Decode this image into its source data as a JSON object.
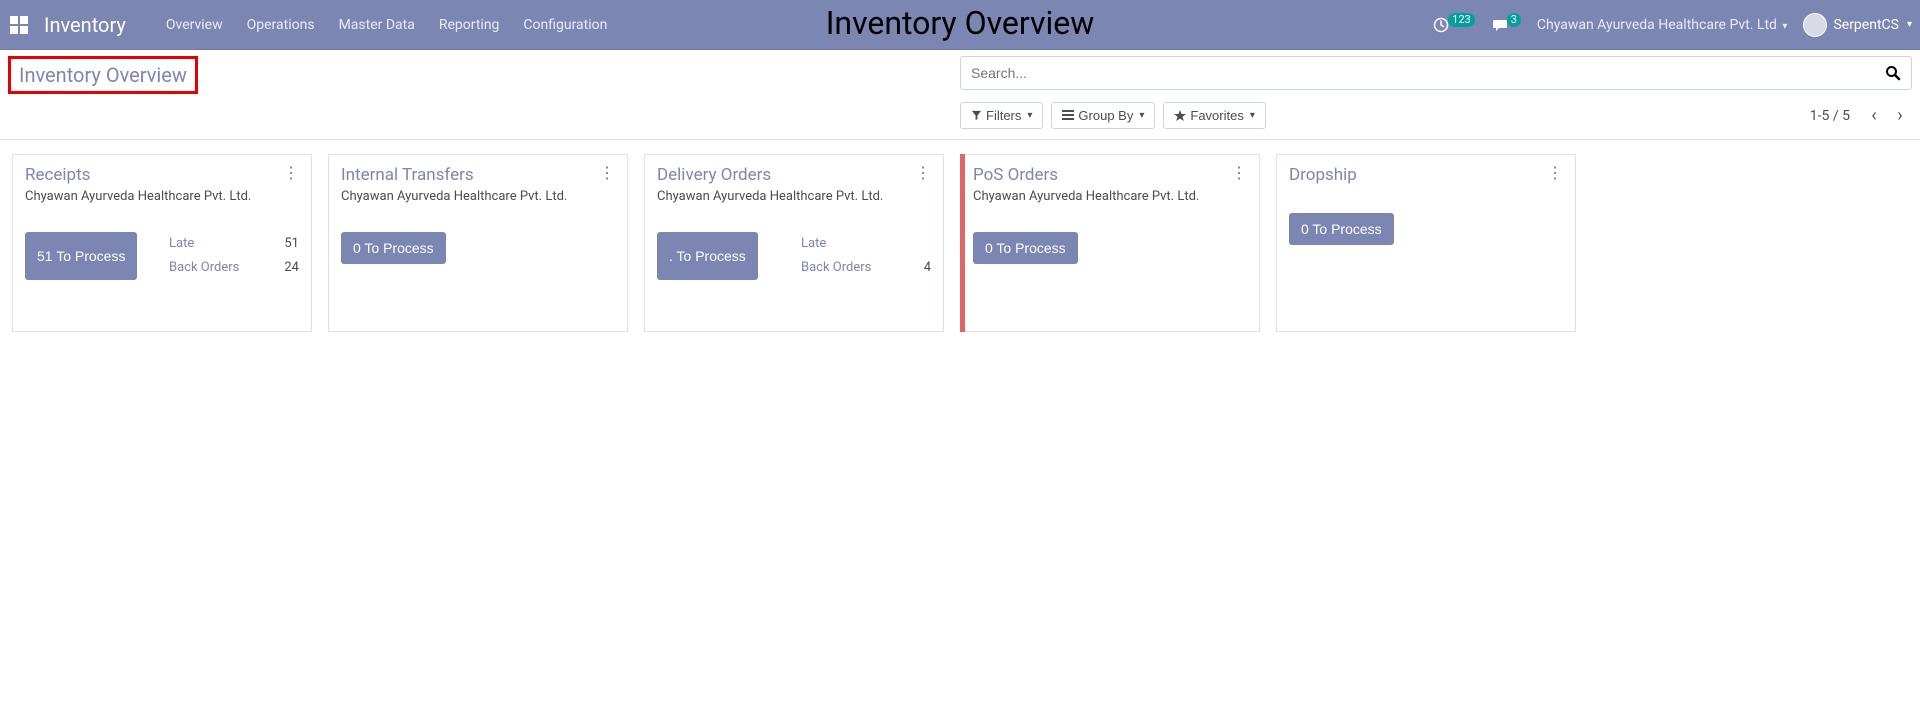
{
  "header": {
    "app_name": "Inventory",
    "menu": [
      "Overview",
      "Operations",
      "Master Data",
      "Reporting",
      "Configuration"
    ],
    "overlay_title": "Inventory Overview",
    "activity_count": "123",
    "discuss_count": "3",
    "company": "Chyawan Ayurveda Healthcare Pvt. Ltd",
    "user": "SerpentCS"
  },
  "control": {
    "breadcrumb": "Inventory Overview",
    "search_placeholder": "Search...",
    "filters_label": "Filters",
    "groupby_label": "Group By",
    "favorites_label": "Favorites",
    "pager": "1-5 / 5"
  },
  "cards": [
    {
      "id": "receipts",
      "title": "Receipts",
      "subtitle": "Chyawan Ayurveda Healthcare Pvt. Ltd.",
      "button": "51 To Process",
      "has_bar": false,
      "stats": [
        {
          "label": "Late",
          "value": "51"
        },
        {
          "label": "Back Orders",
          "value": "24"
        }
      ]
    },
    {
      "id": "internal-transfers",
      "title": "Internal Transfers",
      "subtitle": "Chyawan Ayurveda Healthcare Pvt. Ltd.",
      "button": "0 To Process",
      "has_bar": false,
      "stats": []
    },
    {
      "id": "delivery-orders",
      "title": "Delivery Orders",
      "subtitle": "Chyawan Ayurveda Healthcare Pvt. Ltd.",
      "button": ". To Process",
      "has_bar": false,
      "stats": [
        {
          "label": "Late",
          "value": ""
        },
        {
          "label": "Back Orders",
          "value": "4"
        }
      ]
    },
    {
      "id": "pos-orders",
      "title": "PoS Orders",
      "subtitle": "Chyawan Ayurveda Healthcare Pvt. Ltd.",
      "button": "0 To Process",
      "has_bar": true,
      "stats": []
    },
    {
      "id": "dropship",
      "title": "Dropship",
      "subtitle": "",
      "button": "0 To Process",
      "has_bar": false,
      "stats": []
    }
  ]
}
